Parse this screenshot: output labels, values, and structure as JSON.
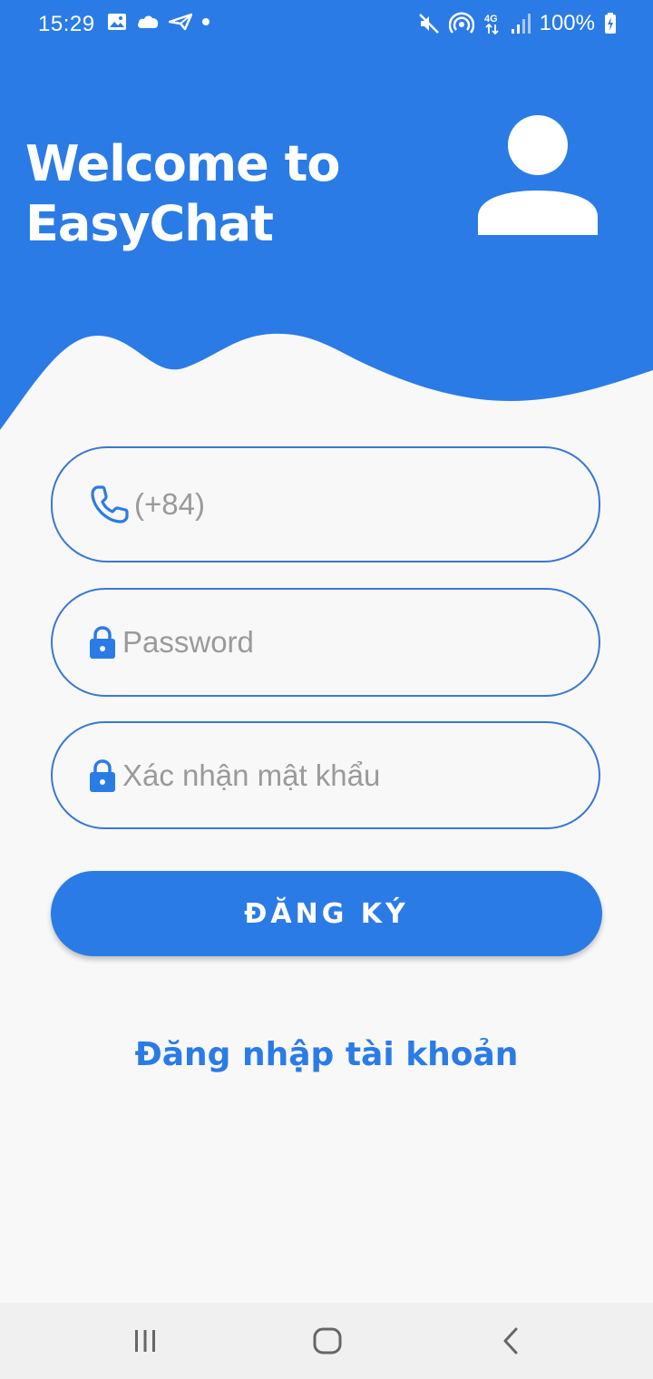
{
  "status_bar": {
    "time": "15:29",
    "battery": "100%",
    "icons": [
      "gallery-icon",
      "cloud-icon",
      "send-icon",
      "dot-icon",
      "mute-icon",
      "hotspot-icon",
      "network-4g-icon",
      "signal-icon",
      "battery-charging-icon"
    ]
  },
  "header": {
    "welcome_line1": "Welcome to",
    "welcome_line2": "EasyChat",
    "avatar_icon": "user-avatar-icon"
  },
  "form": {
    "phone_placeholder": "(+84)",
    "phone_icon": "phone-icon",
    "password_placeholder": "Password",
    "password_icon": "lock-icon",
    "confirm_placeholder": "Xác nhận mật khẩu",
    "confirm_icon": "lock-icon"
  },
  "actions": {
    "register_label": "ĐĂNG KÝ",
    "login_link": "Đăng nhập tài khoản"
  },
  "nav": {
    "icons": [
      "recent-apps-icon",
      "home-icon",
      "back-icon"
    ]
  },
  "colors": {
    "primary": "#2b7be6",
    "border": "#3a78cf",
    "background": "#f8f8f8",
    "placeholder": "#9a9a9a"
  }
}
